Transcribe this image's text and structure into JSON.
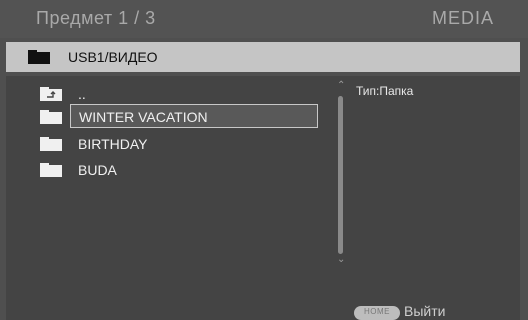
{
  "header": {
    "title": "Предмет  1 / 3",
    "media": "MEDIA"
  },
  "path": {
    "icon": "folder-icon",
    "text": "USB1/ВИДЕО"
  },
  "list": {
    "items": [
      {
        "label": "..",
        "icon": "folder-up-icon",
        "selected": false
      },
      {
        "label": "WINTER VACATION",
        "icon": "folder-icon",
        "selected": true
      },
      {
        "label": "BIRTHDAY",
        "icon": "folder-icon",
        "selected": false
      },
      {
        "label": "BUDA",
        "icon": "folder-icon",
        "selected": false
      }
    ]
  },
  "info": {
    "type_text": "Тип:Папка"
  },
  "footer": {
    "home_label": "HOME",
    "exit_label": "Выйти"
  },
  "colors": {
    "background": "#4f4f4f",
    "path_bar": "#c5c5c5",
    "selection_border": "#c8c8c8"
  }
}
